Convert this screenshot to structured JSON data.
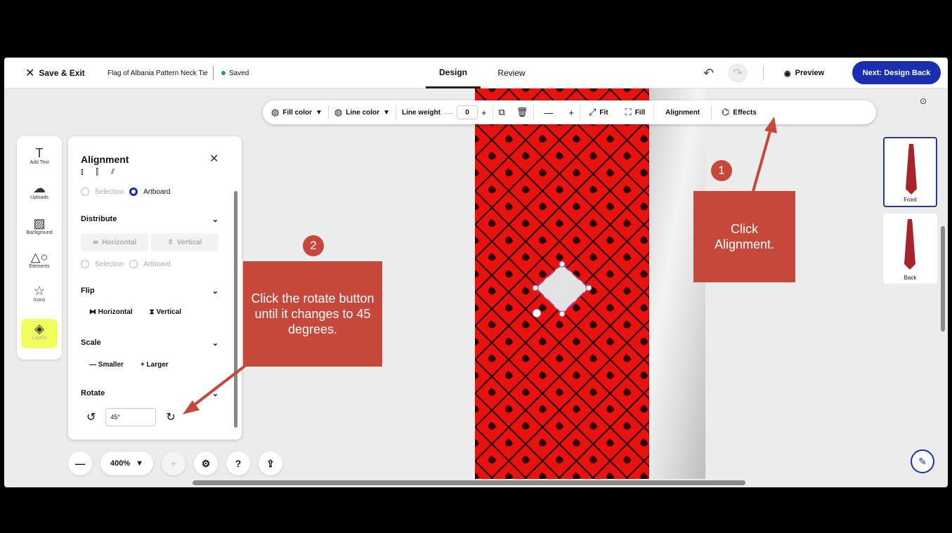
{
  "topbar": {
    "save_exit": "Save & Exit",
    "title": "Flag of Albania Pattern Neck Tie",
    "saved": "Saved",
    "tab_design": "Design",
    "tab_review": "Review",
    "preview": "Preview",
    "next": "Next: Design Back"
  },
  "toolbar": {
    "fill_color": "Fill color",
    "line_color": "Line color",
    "line_weight": "Line weight",
    "line_weight_value": "0",
    "fit": "Fit",
    "fill": "Fill",
    "alignment": "Alignment",
    "effects": "Effects"
  },
  "rail": {
    "add_text": "Add Text",
    "uploads": "Uploads",
    "background": "Background",
    "elements": "Elements",
    "icons": "Icons",
    "layers": "Layers"
  },
  "panel": {
    "title": "Alignment",
    "selection": "Selection",
    "artboard": "Artboard",
    "distribute": "Distribute",
    "horizontal": "Horizontal",
    "vertical": "Vertical",
    "flip": "Flip",
    "scale": "Scale",
    "smaller": "Smaller",
    "larger": "Larger",
    "rotate": "Rotate",
    "rotate_value": "45°"
  },
  "zoom": {
    "value": "400%"
  },
  "thumbnails": {
    "front": "Front",
    "back": "Back"
  },
  "callouts": {
    "badge1": "1",
    "text1": "Click Alignment.",
    "badge2": "2",
    "text2": "Click the rotate button until it changes to 45 degrees."
  },
  "colors": {
    "accent": "#1a2fb0",
    "callout": "#c5483b",
    "tie_red": "#e8120f",
    "saved_dot": "#2e9b4f"
  },
  "icons": [
    "close-icon",
    "undo-icon",
    "redo-icon",
    "eye-icon",
    "fill-color-icon",
    "line-color-icon",
    "duplicate-icon",
    "trash-icon",
    "fit-icon",
    "fill-icon",
    "effects-icon",
    "text-icon",
    "upload-icon",
    "background-icon",
    "elements-icon",
    "star-icon",
    "layers-icon",
    "rotate-left-icon",
    "rotate-right-icon",
    "settings-icon",
    "help-icon",
    "share-icon",
    "chat-icon"
  ]
}
